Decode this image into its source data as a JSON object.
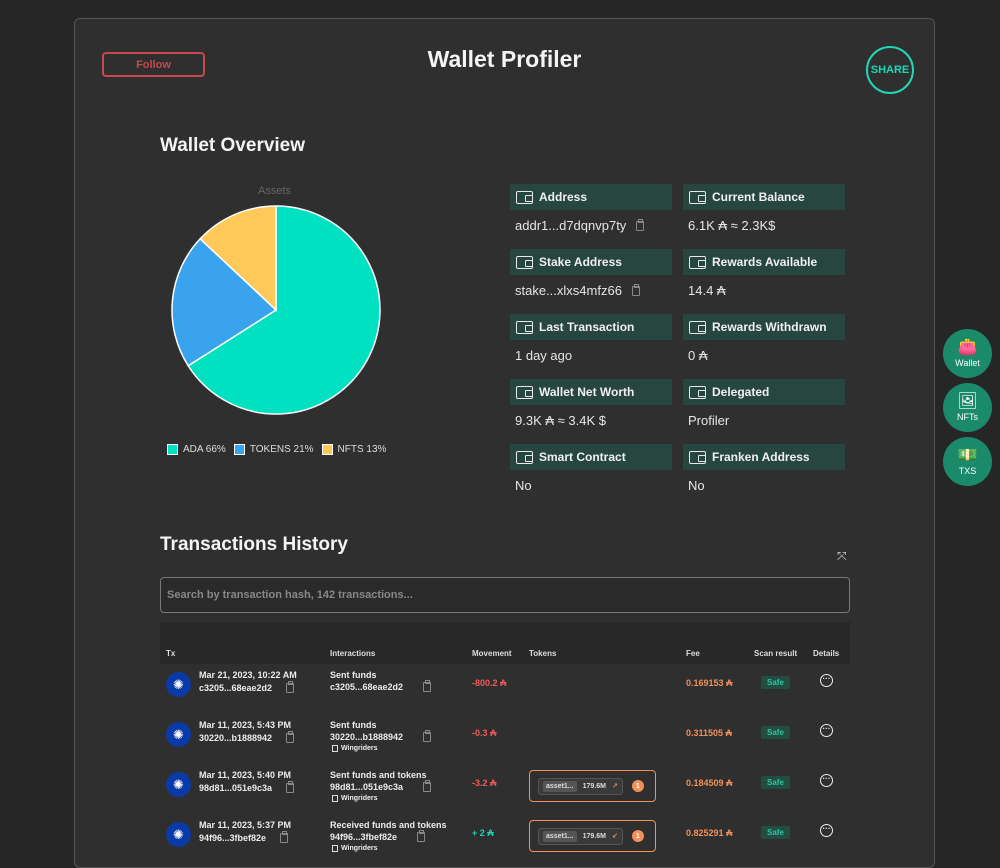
{
  "header": {
    "follow_label": "Follow",
    "title": "Wallet Profiler",
    "share_label": "SHARE"
  },
  "overview": {
    "title": "Wallet Overview",
    "chart_title": "Assets",
    "legend": [
      {
        "label": "ADA 66%",
        "color": "#00e1c1"
      },
      {
        "label": "TOKENS 21%",
        "color": "#3aa3ee"
      },
      {
        "label": "NFTS 13%",
        "color": "#ffc95a"
      }
    ],
    "info": [
      {
        "label": "Address",
        "value": "addr1...d7dqnvp7ty",
        "copy": true
      },
      {
        "label": "Current Balance",
        "value": "6.1K ₳ ≈ 2.3K$",
        "copy": false
      },
      {
        "label": "Stake Address",
        "value": "stake...xlxs4mfz66",
        "copy": true
      },
      {
        "label": "Rewards Available",
        "value": "14.4 ₳",
        "copy": false
      },
      {
        "label": "Last Transaction",
        "value": "1 day ago",
        "copy": false
      },
      {
        "label": "Rewards Withdrawn",
        "value": "0 ₳",
        "copy": false
      },
      {
        "label": "Wallet Net Worth",
        "value": "9.3K ₳ ≈ 3.4K $",
        "copy": false
      },
      {
        "label": "Delegated",
        "value": "Profiler",
        "copy": false
      },
      {
        "label": "Smart Contract",
        "value": "No",
        "copy": false
      },
      {
        "label": "Franken Address",
        "value": "No",
        "copy": false
      }
    ]
  },
  "chart_data": {
    "type": "pie",
    "title": "Assets",
    "categories": [
      "ADA",
      "TOKENS",
      "NFTS"
    ],
    "values": [
      66,
      21,
      13
    ],
    "colors": [
      "#00e1c1",
      "#3aa3ee",
      "#ffc95a"
    ],
    "legend_position": "bottom"
  },
  "transactions": {
    "title": "Transactions History",
    "search_placeholder": "Search by transaction hash, 142 transactions...",
    "columns": [
      "Tx",
      "Interactions",
      "Movement",
      "Tokens",
      "Fee",
      "Scan result",
      "Details"
    ],
    "rows": [
      {
        "date": "Mar 21, 2023, 10:22 AM",
        "hash": "c3205...68eae2d2",
        "interaction": "Sent funds",
        "int_hash": "c3205...68eae2d2",
        "dapp": "",
        "movement": "-800.2 ₳",
        "dir": "neg",
        "token": null,
        "fee": "0.169153 ₳",
        "scan": "Safe"
      },
      {
        "date": "Mar 11, 2023, 5:43 PM",
        "hash": "30220...b1888942",
        "interaction": "Sent funds",
        "int_hash": "30220...b1888942",
        "dapp": "Wingriders",
        "movement": "-0.3 ₳",
        "dir": "neg",
        "token": null,
        "fee": "0.311505 ₳",
        "scan": "Safe"
      },
      {
        "date": "Mar 11, 2023, 5:40 PM",
        "hash": "98d81...051e9c3a",
        "interaction": "Sent funds and tokens",
        "int_hash": "98d81...051e9c3a",
        "dapp": "Wingriders",
        "movement": "-3.2 ₳",
        "dir": "neg",
        "token": {
          "name": "asset1...",
          "amount": "179.6M",
          "arrow": "↗",
          "count": "1"
        },
        "fee": "0.184509 ₳",
        "scan": "Safe"
      },
      {
        "date": "Mar 11, 2023, 5:37 PM",
        "hash": "94f96...3fbef82e",
        "interaction": "Received funds and tokens",
        "int_hash": "94f96...3fbef82e",
        "dapp": "Wingriders",
        "movement": "+ 2 ₳",
        "dir": "pos",
        "token": {
          "name": "asset1...",
          "amount": "179.6M",
          "arrow": "↙",
          "count": "1"
        },
        "fee": "0.825291 ₳",
        "scan": "Safe"
      }
    ]
  },
  "side_nav": [
    {
      "label": "Wallet",
      "icon": "wallet-icon",
      "glyph": "👛"
    },
    {
      "label": "NFTs",
      "icon": "nfts-icon",
      "glyph": "🖼"
    },
    {
      "label": "TXS",
      "icon": "txs-icon",
      "glyph": "💵"
    }
  ]
}
